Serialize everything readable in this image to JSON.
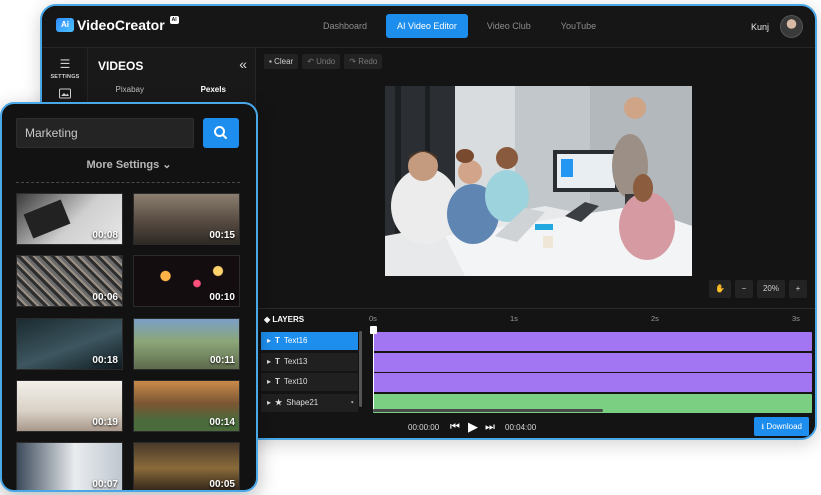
{
  "app": {
    "logo_text": "VideoCreator",
    "logo_mark": "Ai",
    "logo_badge": "AI"
  },
  "nav": {
    "items": [
      {
        "label": "Dashboard",
        "active": false
      },
      {
        "label": "AI Video Editor",
        "active": true
      },
      {
        "label": "Video Club",
        "active": false
      },
      {
        "label": "YouTube",
        "active": false
      }
    ]
  },
  "user": {
    "name": "Kunj"
  },
  "sidebar": {
    "rail": [
      {
        "label": "SETTINGS",
        "icon": "sliders-icon"
      },
      {
        "label": "",
        "icon": "media-icon"
      }
    ]
  },
  "videos_panel": {
    "title": "VIDEOS",
    "collapse_glyph": "«",
    "tabs": [
      {
        "label": "Pixabay",
        "active": false
      },
      {
        "label": "Pexels",
        "active": true
      }
    ]
  },
  "toolbar": {
    "clear": "Clear",
    "undo": "Undo",
    "redo": "Redo"
  },
  "zoom": {
    "value": "20%"
  },
  "timeline": {
    "layers_title": "LAYERS",
    "ticks": [
      "0s",
      "1s",
      "2s",
      "3s"
    ],
    "layers": [
      {
        "name": "Text16",
        "kind": "text",
        "active": true
      },
      {
        "name": "Text13",
        "kind": "text",
        "active": false
      },
      {
        "name": "Text10",
        "kind": "text",
        "active": false
      },
      {
        "name": "Shape21",
        "kind": "shape",
        "active": false
      }
    ],
    "current_time": "00:00:00",
    "total_time": "00:04:00",
    "download_label": "Download"
  },
  "search": {
    "value": "Marketing",
    "more_settings": "More Settings"
  },
  "results": [
    {
      "duration": "00:08",
      "scene": "branding-mockup"
    },
    {
      "duration": "00:15",
      "scene": "street-crowd"
    },
    {
      "duration": "00:06",
      "scene": "crowd-aerial"
    },
    {
      "duration": "00:10",
      "scene": "night-lights"
    },
    {
      "duration": "00:18",
      "scene": "keyboard-typing"
    },
    {
      "duration": "00:11",
      "scene": "park-people"
    },
    {
      "duration": "00:19",
      "scene": "office-meeting"
    },
    {
      "duration": "00:14",
      "scene": "market-stall"
    },
    {
      "duration": "00:07",
      "scene": "presentation-board"
    },
    {
      "duration": "00:05",
      "scene": "market-night"
    }
  ],
  "colors": {
    "accent": "#1e8eee",
    "text_track": "#a276f2",
    "shape_track": "#7bcf83",
    "frame_border": "#4aa8e8"
  }
}
